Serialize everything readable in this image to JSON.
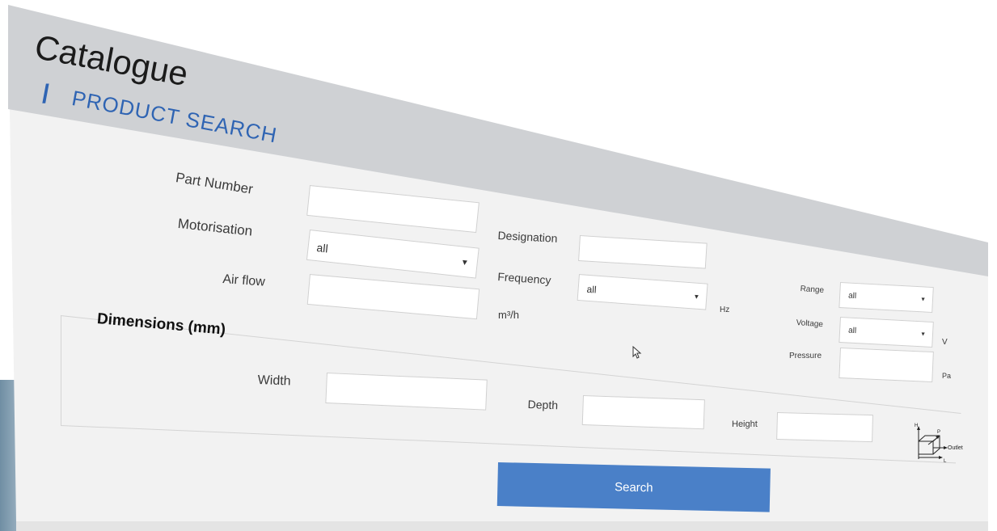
{
  "app": {
    "title": "Catalogue"
  },
  "section": {
    "slash": "/",
    "title": "PRODUCT SEARCH"
  },
  "form": {
    "part_number": {
      "label": "Part Number",
      "value": ""
    },
    "motorisation": {
      "label": "Motorisation",
      "selected": "all"
    },
    "air_flow": {
      "label": "Air flow",
      "value": "",
      "unit": "m³/h"
    },
    "designation": {
      "label": "Designation",
      "value": ""
    },
    "frequency": {
      "label": "Frequency",
      "selected": "all",
      "unit": "Hz"
    },
    "range": {
      "label": "Range",
      "selected": "all"
    },
    "voltage": {
      "label": "Voltage",
      "selected": "all",
      "unit": "V"
    },
    "pressure": {
      "label": "Pressure",
      "value": "",
      "unit": "Pa"
    }
  },
  "dimensions": {
    "title": "Dimensions (mm)",
    "width_label": "Width",
    "depth_label": "Depth",
    "height_label": "Height",
    "diagram": {
      "h": "H",
      "p": "P",
      "l": "L",
      "outlet": "Outlet"
    }
  },
  "actions": {
    "search_label": "Search"
  },
  "icons": {
    "caret": "chevron-down-icon",
    "cursor": "mouse-cursor-icon",
    "diagram": "dimensions-diagram-icon"
  },
  "colors": {
    "accent": "#2f64b3",
    "button": "#4a80c8",
    "panel": "#f2f2f2",
    "header": "#cfd1d4"
  }
}
